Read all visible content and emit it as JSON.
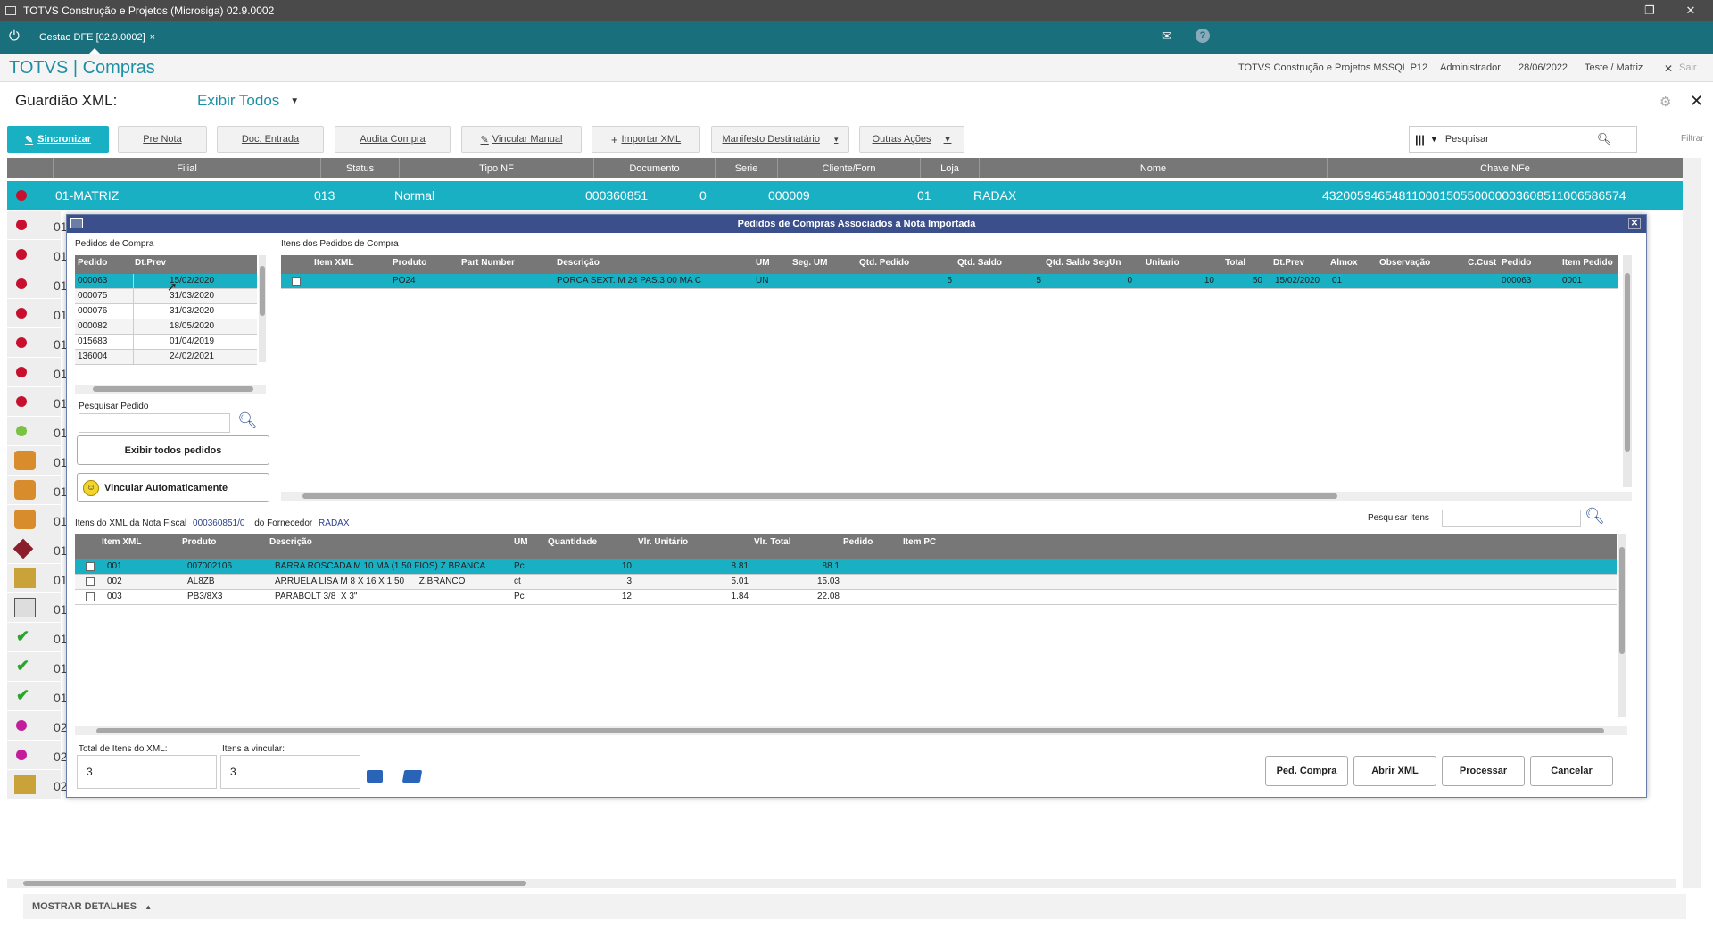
{
  "window": {
    "title": "TOTVS Construção e Projetos (Microsiga) 02.9.0002"
  },
  "tab": {
    "label": "Gestao DFE [02.9.0002]",
    "close": "×"
  },
  "app": {
    "brand": "TOTVS | Compras",
    "company": "TOTVS Construção e Projetos MSSQL P12",
    "user": "Administrador",
    "date": "28/06/2022",
    "branch": "Teste / Matriz",
    "exit": "Sair"
  },
  "header": {
    "title": "Guardião XML:",
    "filter_label": "Exibir Todos"
  },
  "toolbar": {
    "sync": "Sincronizar",
    "pre_nota": "Pre Nota",
    "doc_entrada": "Doc. Entrada",
    "audita": "Audita Compra",
    "vincular_manual": "Vincular Manual",
    "importar_xml": "Importar XML",
    "manifesto": "Manifesto Destinatário",
    "outras": "Outras Ações",
    "search_placeholder": "Pesquisar",
    "filter": "Filtrar"
  },
  "main_grid": {
    "columns": [
      "Filial",
      "Status",
      "Tipo NF",
      "Documento",
      "Serie",
      "Cliente/Forn",
      "Loja",
      "Nome",
      "Chave NFe"
    ],
    "selected_row": {
      "filial": "01-MATRIZ",
      "status": "013",
      "tipo": "Normal",
      "documento": "000360851",
      "serie": "0",
      "cliente": "000009",
      "loja": "01",
      "nome": "RADAX",
      "chave": "43200594654811000150550000003608511006586574"
    },
    "row_prefix_a": "01",
    "row_prefix_b": "02"
  },
  "dialog": {
    "title": "Pedidos de Compras Associados a Nota Importada",
    "pedidos_label": "Pedidos de Compra",
    "pedidos_cols": [
      "Pedido",
      "Dt.Prev"
    ],
    "pedidos": [
      {
        "pedido": "000063",
        "dt": "15/02/2020"
      },
      {
        "pedido": "000075",
        "dt": "31/03/2020"
      },
      {
        "pedido": "000076",
        "dt": "31/03/2020"
      },
      {
        "pedido": "000082",
        "dt": "18/05/2020"
      },
      {
        "pedido": "015683",
        "dt": "01/04/2019"
      },
      {
        "pedido": "136004",
        "dt": "24/02/2021"
      }
    ],
    "pesquisar_pedido_label": "Pesquisar Pedido",
    "exibir_todos": "Exibir todos pedidos",
    "vincular_auto": "Vincular Automaticamente",
    "itens_pedidos_label": "Itens dos Pedidos de Compra",
    "itens_pedidos_cols": [
      "Item XML",
      "Produto",
      "Part Number",
      "Descrição",
      "UM",
      "Seg. UM",
      "Qtd. Pedido",
      "Qtd. Saldo",
      "Qtd. Saldo SegUn",
      "Unitario",
      "Total",
      "Dt.Prev",
      "Almox",
      "Observação",
      "C.Cust",
      "Pedido",
      "Item Pedido"
    ],
    "itens_pedidos_row": {
      "produto": "PO24",
      "descricao": "PORCA SEXT. M 24 PAS.3.00 MA C",
      "um": "UN",
      "qtd_pedido": "5",
      "qtd_saldo": "5",
      "qtd_saldo_segun": "0",
      "unitario": "10",
      "total": "50",
      "dt_prev": "15/02/2020",
      "almox": "01",
      "pedido": "000063",
      "item_pedido": "0001"
    },
    "xml_label_prefix": "Itens do XML da Nota Fiscal",
    "xml_nf": "000360851/0",
    "xml_label_mid": "do Fornecedor",
    "xml_forn": "RADAX",
    "pesquisar_itens": "Pesquisar Itens",
    "xml_cols": [
      "Item XML",
      "Produto",
      "Descrição",
      "UM",
      "Quantidade",
      "Vlr. Unitário",
      "Vlr. Total",
      "Pedido",
      "Item PC"
    ],
    "xml_rows": [
      {
        "item": "001",
        "produto": "007002106",
        "desc": "BARRA ROSCADA M 10 MA (1.50 FIOS) Z.BRANCA",
        "um": "Pc",
        "qtd": "10",
        "unit": "8.81",
        "total": "88.1"
      },
      {
        "item": "002",
        "produto": "AL8ZB",
        "desc": "ARRUELA LISA M 8 X 16 X 1.50      Z.BRANCO",
        "um": "ct",
        "qtd": "3",
        "unit": "5.01",
        "total": "15.03"
      },
      {
        "item": "003",
        "produto": "PB3/8X3",
        "desc": "PARABOLT 3/8  X 3\"",
        "um": "Pc",
        "qtd": "12",
        "unit": "1.84",
        "total": "22.08"
      }
    ],
    "total_itens_label": "Total de Itens do XML:",
    "total_itens_value": "3",
    "itens_vincular_label": "Itens a vincular:",
    "itens_vincular_value": "3",
    "btn_ped_compra": "Ped. Compra",
    "btn_abrir_xml": "Abrir XML",
    "btn_processar": "Processar",
    "btn_cancelar": "Cancelar"
  },
  "footer": {
    "details": "MOSTRAR DETALHES"
  },
  "colors": {
    "teal": "#1a6f7c",
    "selected": "#1ab0c4",
    "header_grey": "#777777",
    "dialog_title": "#3b4f8c"
  }
}
